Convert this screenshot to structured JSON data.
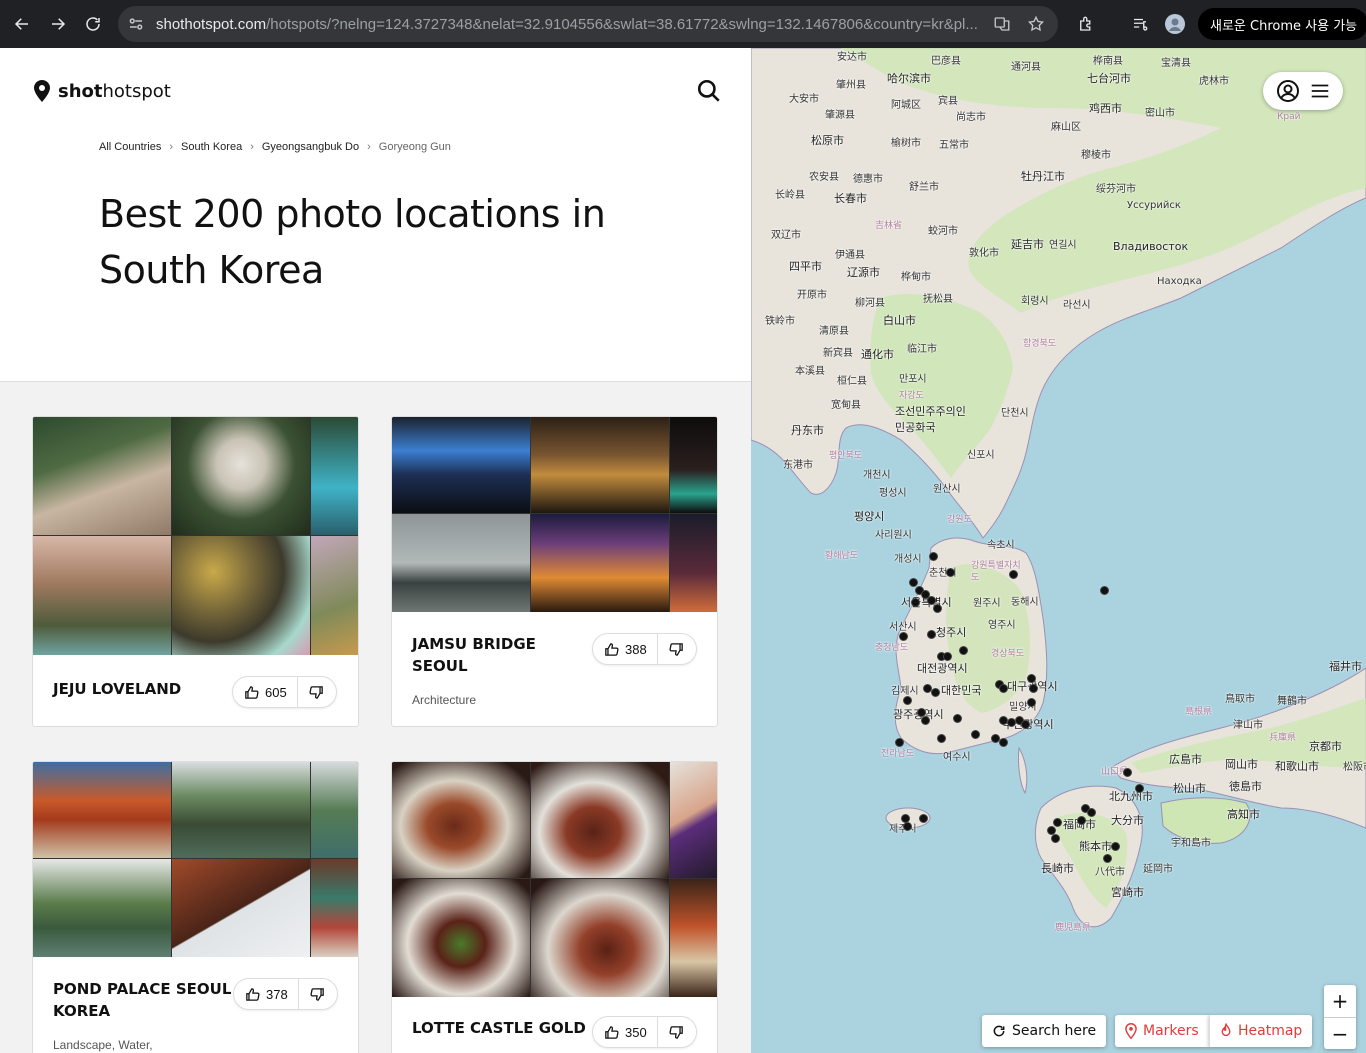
{
  "browser": {
    "url_host": "shothotspot.com",
    "url_path": "/hotspots/?nelng=124.3727348&nelat=32.9104556&swlat=38.61772&swlng=132.1467806&country=kr&pl...",
    "update_label": "새로운 Chrome 사용 가능"
  },
  "site": {
    "logo_text_bold": "shot",
    "logo_text": "hotspot"
  },
  "breadcrumbs": [
    "All Countries",
    "South Korea",
    "Gyeongsangbuk Do",
    "Goryeong Gun"
  ],
  "page_title": "Best 200 photo locations in South Korea",
  "cards": [
    {
      "title": "JEJU LOVELAND",
      "likes": "605",
      "tags": ""
    },
    {
      "title": "JAMSU BRIDGE SEOUL",
      "likes": "388",
      "tags": "Architecture"
    },
    {
      "title": "POND PALACE SEOUL KOREA",
      "likes": "378",
      "tags": "Landscape, Water,"
    },
    {
      "title": "LOTTE CASTLE GOLD",
      "likes": "350",
      "tags": ""
    }
  ],
  "map": {
    "search_here": "Search here",
    "markers": "Markers",
    "heatmap": "Heatmap",
    "zoom_in": "+",
    "zoom_out": "−",
    "labels": [
      "安达市",
      "巴彦县",
      "通河县",
      "桦南县",
      "宝清县",
      "哈尔滨市",
      "七台河市",
      "虎林市",
      "大安市",
      "肇州县",
      "阿城区",
      "宾县",
      "尚志市",
      "鸡西市",
      "密山市",
      "肇源县",
      "松原市",
      "榆树市",
      "五常市",
      "麻山区",
      "穆棱市",
      "农安县",
      "德惠市",
      "舒兰市",
      "牡丹江市",
      "绥芬河市",
      "长春市",
      "长岭县",
      "Уссурийск",
      "双辽市",
      "吉林省",
      "蛟河市",
      "延吉市",
      "연길시",
      "Владивосток",
      "伊通县",
      "敦化市",
      "四平市",
      "辽源市",
      "桦甸市",
      "Находка",
      "开原市",
      "抚松县",
      "회령시",
      "라선시",
      "柳河县",
      "铁岭市",
      "白山市",
      "함경북도",
      "清原县",
      "新宾县",
      "通化市",
      "临江市",
      "本溪县",
      "桓仁县",
      "만포시",
      "宽甸县",
      "자강도",
      "단천시",
      "조선민주주의인민공화국",
      "丹东市",
      "신포시",
      "东港市",
      "평안북도",
      "개천시",
      "원산시",
      "평성시",
      "평양시",
      "강원도",
      "사리원시",
      "황해남도",
      "개성시",
      "속초시",
      "춘천시",
      "강원특별자치도",
      "서울특별시",
      "원주시",
      "동해시",
      "서산시",
      "청주시",
      "영주시",
      "충청남도",
      "대전광역시",
      "경상북도",
      "김제시",
      "대한민국",
      "대구광역시",
      "광주광역시",
      "밀양시",
      "부산광역시",
      "전라남도",
      "여수시",
      "제주시",
      "鳥取市",
      "舞鶴市",
      "福井市",
      "島根県",
      "津山市",
      "兵庫県",
      "京都市",
      "山口県",
      "広島市",
      "岡山市",
      "和歌山市",
      "北九州市",
      "松山市",
      "徳島市",
      "福岡市",
      "大分市",
      "高知市",
      "宇和島市",
      "長崎市",
      "熊本市",
      "八代市",
      "延岡市",
      "宮崎市",
      "鹿児島県",
      "松阪市",
      "鹿児島県",
      "Край"
    ]
  }
}
